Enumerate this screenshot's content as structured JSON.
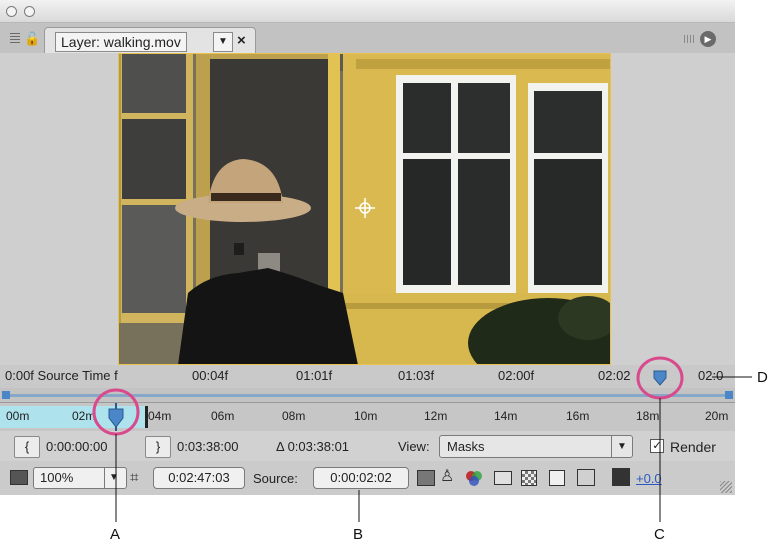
{
  "window": {
    "tab_title": "Layer: walking.mov",
    "tab_dropdown": "▼",
    "tab_close": "×",
    "panel_menu": "▶"
  },
  "timebar": {
    "source_time_label": "0:00f Source Time f",
    "times": [
      "00:04f",
      "01:01f",
      "01:03f",
      "02:00f",
      "02:02",
      "02:0"
    ]
  },
  "ruler": {
    "labels": [
      "00m",
      "02m",
      "04m",
      "06m",
      "08m",
      "10m",
      "12m",
      "14m",
      "16m",
      "18m",
      "20m"
    ]
  },
  "controls": {
    "in_button": "{",
    "in_time": "0:00:00:00",
    "out_button": "}",
    "out_time": "0:03:38:00",
    "duration": "Δ 0:03:38:01",
    "view_label": "View:",
    "view_value": "Masks",
    "render_label": "Render",
    "render_checked": true
  },
  "bottombar": {
    "magnification": "100%",
    "current_time": "0:02:47:03",
    "source_label": "Source:",
    "source_time": "0:00:02:02",
    "exposure": "+0.0"
  },
  "callouts": [
    "A",
    "B",
    "C",
    "D"
  ],
  "colors": {
    "frame_border": "#e8c250",
    "callout_ring": "#d94a8c",
    "ruler_fill": "#aee2ec",
    "marker_blue": "#4a86c8"
  }
}
